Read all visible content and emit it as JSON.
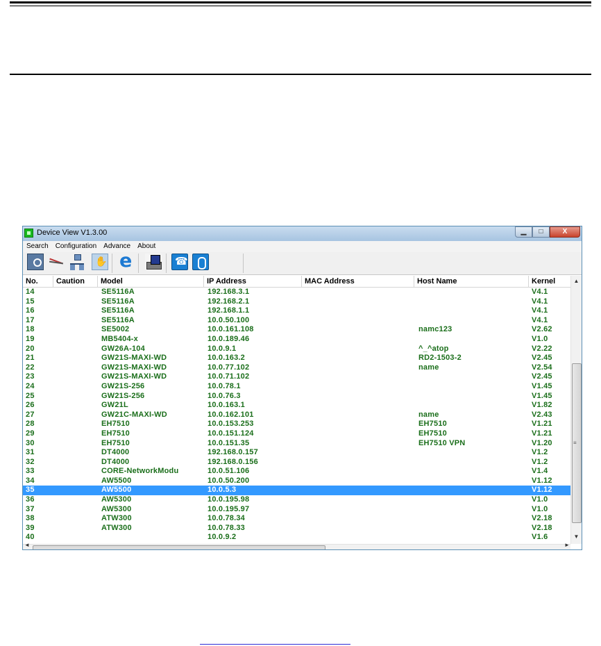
{
  "window": {
    "title": "Device View V1.3.00",
    "controls": {
      "minimize": "▁",
      "maximize": "□",
      "close": "X"
    }
  },
  "menu": [
    "Search",
    "Configuration",
    "Advance",
    "About"
  ],
  "toolbar_icons": [
    "search-device-icon",
    "cable-icon",
    "network-icon",
    "hand-icon",
    "internet-explorer-icon",
    "print-icon",
    "phone-icon",
    "mouse-icon"
  ],
  "columns": [
    "No.",
    "Caution",
    "Model",
    "IP Address",
    "MAC Address",
    "Host Name",
    "Kernel"
  ],
  "rows": [
    {
      "no": "14",
      "caution": "",
      "model": "SE5116A",
      "ip": "192.168.3.1",
      "mac": "",
      "host": "",
      "kernel": "V4.1"
    },
    {
      "no": "15",
      "caution": "",
      "model": "SE5116A",
      "ip": "192.168.2.1",
      "mac": "",
      "host": "",
      "kernel": "V4.1"
    },
    {
      "no": "16",
      "caution": "",
      "model": "SE5116A",
      "ip": "192.168.1.1",
      "mac": "",
      "host": "",
      "kernel": "V4.1"
    },
    {
      "no": "17",
      "caution": "",
      "model": "SE5116A",
      "ip": "10.0.50.100",
      "mac": "",
      "host": "",
      "kernel": "V4.1"
    },
    {
      "no": "18",
      "caution": "",
      "model": "SE5002",
      "ip": "10.0.161.108",
      "mac": "",
      "host": "namc123",
      "kernel": "V2.62"
    },
    {
      "no": "19",
      "caution": "",
      "model": "MB5404-x",
      "ip": "10.0.189.46",
      "mac": "",
      "host": "",
      "kernel": "V1.0"
    },
    {
      "no": "20",
      "caution": "",
      "model": "GW26A-104",
      "ip": "10.0.9.1",
      "mac": "",
      "host": "^_^atop",
      "kernel": "V2.22"
    },
    {
      "no": "21",
      "caution": "",
      "model": "GW21S-MAXI-WD",
      "ip": "10.0.163.2",
      "mac": "",
      "host": "RD2-1503-2",
      "kernel": "V2.45"
    },
    {
      "no": "22",
      "caution": "",
      "model": "GW21S-MAXI-WD",
      "ip": "10.0.77.102",
      "mac": "",
      "host": "name",
      "kernel": "V2.54"
    },
    {
      "no": "23",
      "caution": "",
      "model": "GW21S-MAXI-WD",
      "ip": "10.0.71.102",
      "mac": "",
      "host": "",
      "kernel": "V2.45"
    },
    {
      "no": "24",
      "caution": "",
      "model": "GW21S-256",
      "ip": "10.0.78.1",
      "mac": "",
      "host": "",
      "kernel": "V1.45"
    },
    {
      "no": "25",
      "caution": "",
      "model": "GW21S-256",
      "ip": "10.0.76.3",
      "mac": "",
      "host": "",
      "kernel": "V1.45"
    },
    {
      "no": "26",
      "caution": "",
      "model": "GW21L",
      "ip": "10.0.163.1",
      "mac": "",
      "host": "",
      "kernel": "V1.82"
    },
    {
      "no": "27",
      "caution": "",
      "model": "GW21C-MAXI-WD",
      "ip": "10.0.162.101",
      "mac": "",
      "host": "name",
      "kernel": "V2.43"
    },
    {
      "no": "28",
      "caution": "",
      "model": "EH7510",
      "ip": "10.0.153.253",
      "mac": "",
      "host": "EH7510",
      "kernel": "V1.21"
    },
    {
      "no": "29",
      "caution": "",
      "model": "EH7510",
      "ip": "10.0.151.124",
      "mac": "",
      "host": "EH7510",
      "kernel": "V1.21"
    },
    {
      "no": "30",
      "caution": "",
      "model": "EH7510",
      "ip": "10.0.151.35",
      "mac": "",
      "host": "EH7510 VPN",
      "kernel": "V1.20"
    },
    {
      "no": "31",
      "caution": "",
      "model": "DT4000",
      "ip": "192.168.0.157",
      "mac": "",
      "host": "",
      "kernel": "V1.2"
    },
    {
      "no": "32",
      "caution": "",
      "model": "DT4000",
      "ip": "192.168.0.156",
      "mac": "",
      "host": "",
      "kernel": "V1.2"
    },
    {
      "no": "33",
      "caution": "",
      "model": "CORE-NetworkModu",
      "ip": "10.0.51.106",
      "mac": "",
      "host": "",
      "kernel": "V1.4"
    },
    {
      "no": "34",
      "caution": "",
      "model": "AW5500",
      "ip": "10.0.50.200",
      "mac": "",
      "host": "",
      "kernel": "V1.12"
    },
    {
      "no": "35",
      "caution": "",
      "model": "AW5500",
      "ip": "10.0.5.3",
      "mac": "",
      "host": "",
      "kernel": "V1.12",
      "selected": true
    },
    {
      "no": "36",
      "caution": "",
      "model": "AW5300",
      "ip": "10.0.195.98",
      "mac": "",
      "host": "",
      "kernel": "V1.0"
    },
    {
      "no": "37",
      "caution": "",
      "model": "AW5300",
      "ip": "10.0.195.97",
      "mac": "",
      "host": "",
      "kernel": "V1.0"
    },
    {
      "no": "38",
      "caution": "",
      "model": "ATW300",
      "ip": "10.0.78.34",
      "mac": "",
      "host": "",
      "kernel": "V2.18"
    },
    {
      "no": "39",
      "caution": "",
      "model": "ATW300",
      "ip": "10.0.78.33",
      "mac": "",
      "host": "",
      "kernel": "V2.18"
    },
    {
      "no": "40",
      "caution": "",
      "model": "",
      "ip": "10.0.9.2",
      "mac": "",
      "host": "",
      "kernel": "V1.6"
    }
  ],
  "colors": {
    "row_text": "#1a6e1a",
    "selection": "#3399ff"
  }
}
